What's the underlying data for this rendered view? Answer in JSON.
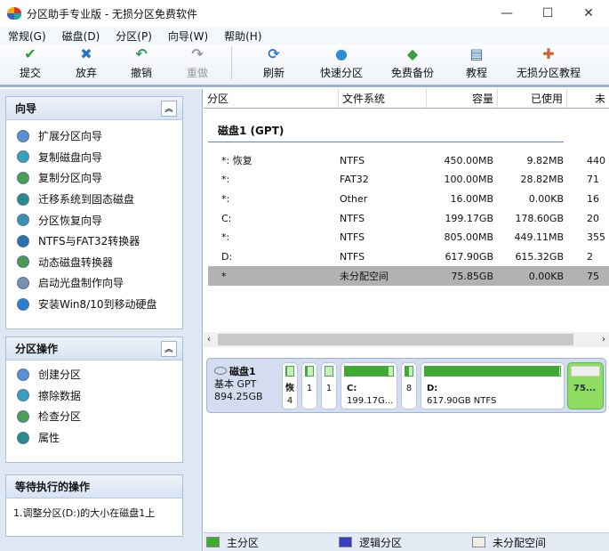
{
  "window": {
    "title": "分区助手专业版 - 无损分区免费软件",
    "minimize": "—",
    "maximize": "☐",
    "close": "✕"
  },
  "menu": [
    "常规(G)",
    "磁盘(D)",
    "分区(P)",
    "向导(W)",
    "帮助(H)"
  ],
  "toolbar": [
    {
      "label": "提交",
      "icon": "check-icon",
      "color": "#2a9d2a",
      "glyph": "✔"
    },
    {
      "label": "放弃",
      "icon": "discard-icon",
      "color": "#2277cc",
      "glyph": "✖"
    },
    {
      "label": "撤销",
      "icon": "undo-icon",
      "color": "#2a9d5a",
      "glyph": "↶"
    },
    {
      "label": "重做",
      "icon": "redo-icon",
      "color": "#999999",
      "glyph": "↷"
    },
    {
      "label": "刷新",
      "icon": "refresh-icon",
      "color": "#3b78c8",
      "glyph": "⟳"
    },
    {
      "label": "快速分区",
      "icon": "quick-partition-icon",
      "color": "#2a8fd0",
      "glyph": "●"
    },
    {
      "label": "免费备份",
      "icon": "backup-icon",
      "color": "#3aa040",
      "glyph": "◆"
    },
    {
      "label": "教程",
      "icon": "tutorial-icon",
      "color": "#3a6fc0",
      "glyph": "▤"
    },
    {
      "label": "无损分区教程",
      "icon": "lossless-tutorial-icon",
      "color": "#d06030",
      "glyph": "✚"
    }
  ],
  "wizard": {
    "title": "向导",
    "items": [
      "扩展分区向导",
      "复制磁盘向导",
      "复制分区向导",
      "迁移系统到固态磁盘",
      "分区恢复向导",
      "NTFS与FAT32转换器",
      "动态磁盘转换器",
      "启动光盘制作向导",
      "安装Win8/10到移动硬盘"
    ]
  },
  "partition_ops": {
    "title": "分区操作",
    "items": [
      "创建分区",
      "擦除数据",
      "检查分区",
      "属性"
    ]
  },
  "pending": {
    "title": "等待执行的操作",
    "items": [
      "1.调整分区(D:)的大小在磁盘1上"
    ]
  },
  "table": {
    "columns": [
      "分区",
      "文件系统",
      "容量",
      "已使用",
      "未"
    ],
    "disk_header": "磁盘1 (GPT)",
    "rows": [
      [
        "*: 恢复",
        "NTFS",
        "450.00MB",
        "9.82MB",
        "440"
      ],
      [
        "*:",
        "FAT32",
        "100.00MB",
        "28.82MB",
        "71"
      ],
      [
        "*:",
        "Other",
        "16.00MB",
        "0.00KB",
        "16"
      ],
      [
        "C:",
        "NTFS",
        "199.17GB",
        "178.60GB",
        "20"
      ],
      [
        "*:",
        "NTFS",
        "805.00MB",
        "449.11MB",
        "355"
      ],
      [
        "D:",
        "NTFS",
        "617.90GB",
        "615.32GB",
        "2"
      ],
      [
        "*",
        "未分配空间",
        "75.85GB",
        "0.00KB",
        "75"
      ]
    ],
    "selected_row": 6
  },
  "diskmap": {
    "name": "磁盘1",
    "type": "基本 GPT",
    "size": "894.25GB",
    "partitions": [
      {
        "l1": "恢",
        "l2": "4",
        "used": 0.02
      },
      {
        "l1": "",
        "l2": "1",
        "used": 0.29
      },
      {
        "l1": "",
        "l2": "1",
        "used": 0
      },
      {
        "l1": "C:",
        "l2": "199.17G...",
        "used": 0.9
      },
      {
        "l1": "",
        "l2": "8",
        "used": 0.56
      },
      {
        "l1": "D:",
        "l2": "617.90GB NTFS",
        "used": 0.996
      },
      {
        "l1": "",
        "l2": "75...",
        "used": 0
      }
    ]
  },
  "legend": {
    "primary": "主分区",
    "logical": "逻辑分区",
    "unallocated": "未分配空间",
    "colors": {
      "primary": "#3faa30",
      "logical": "#3a3fc0",
      "unallocated": "#f0ece6"
    }
  }
}
